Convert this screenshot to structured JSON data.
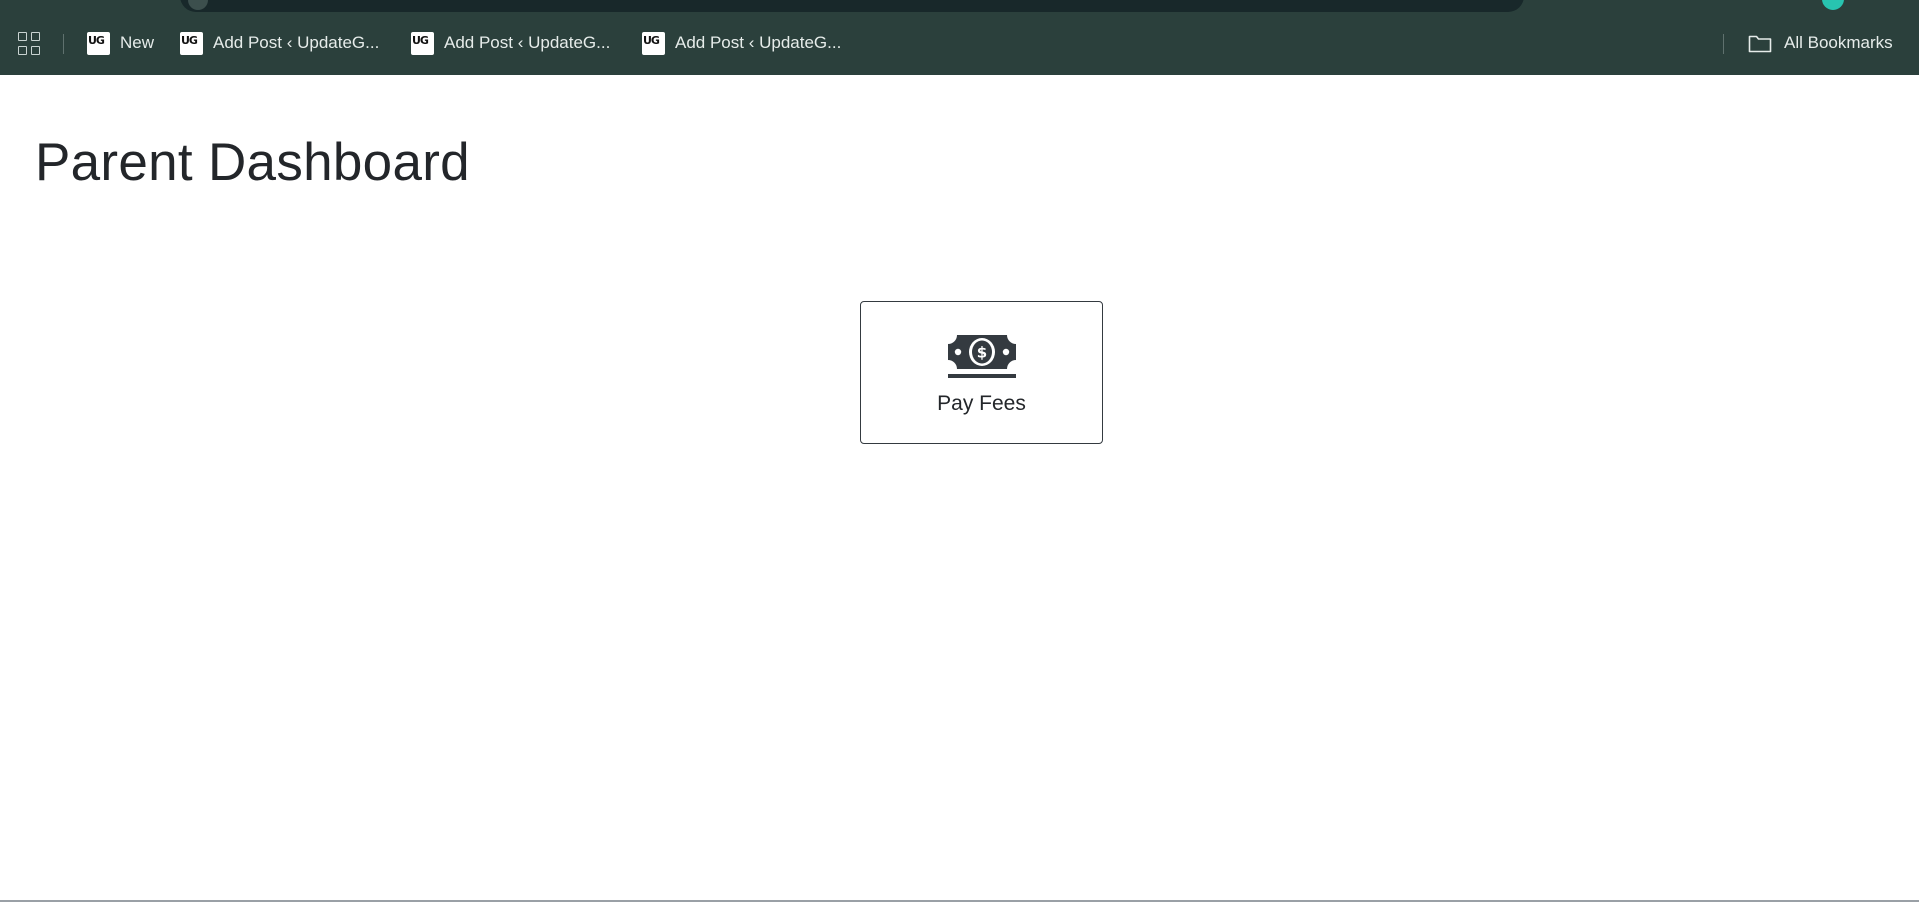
{
  "browser": {
    "bookmarks": [
      {
        "label": "New"
      },
      {
        "label": "Add Post ‹ UpdateG..."
      },
      {
        "label": "Add Post ‹ UpdateG..."
      },
      {
        "label": "Add Post ‹ UpdateG..."
      }
    ],
    "all_bookmarks_label": "All Bookmarks"
  },
  "page": {
    "title": "Parent Dashboard",
    "actions": [
      {
        "label": "Pay Fees",
        "icon": "money-bill-icon"
      }
    ]
  },
  "colors": {
    "toolbar_bg": "#2b403c",
    "text_dark": "#23262a",
    "card_border": "#343a40"
  }
}
